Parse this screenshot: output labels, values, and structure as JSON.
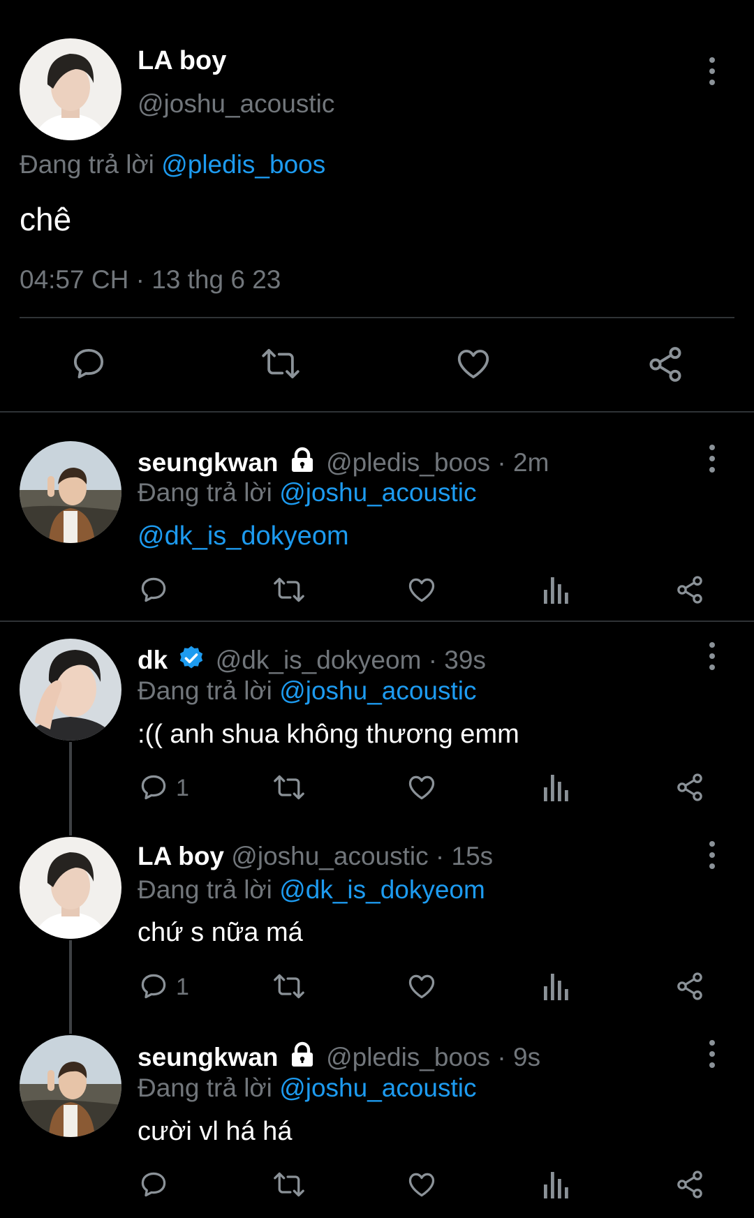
{
  "main_tweet": {
    "name": "LA boy",
    "handle": "@joshu_acoustic",
    "reply_prefix": "Đang trả lời",
    "reply_to": "@pledis_boos",
    "text": "chê",
    "timestamp": "04:57 CH · 13 thg 6 23"
  },
  "replies": [
    {
      "name": "seungkwan",
      "handle": "@pledis_boos",
      "time": "· 2m",
      "reply_prefix": "Đang trả lời",
      "reply_to": "@joshu_acoustic",
      "text": "@dk_is_dokyeom",
      "reply_count": "",
      "badge": "lock-icon"
    },
    {
      "name": "dk",
      "handle": "@dk_is_dokyeom",
      "time": "· 39s",
      "reply_prefix": "Đang trả lời",
      "reply_to": "@joshu_acoustic",
      "text": ":(( anh shua không thương emm",
      "reply_count": "1",
      "badge": "verified-icon"
    },
    {
      "name": "LA boy",
      "handle": "@joshu_acoustic",
      "time": "· 15s",
      "reply_prefix": "Đang trả lời",
      "reply_to": "@dk_is_dokyeom",
      "text": "chứ s nữa má",
      "reply_count": "1",
      "badge": ""
    },
    {
      "name": "seungkwan",
      "handle": "@pledis_boos",
      "time": "· 9s",
      "reply_prefix": "Đang trả lời",
      "reply_to": "@joshu_acoustic",
      "text": "cười vl há há",
      "reply_count": "",
      "badge": "lock-icon"
    }
  ],
  "colors": {
    "background": "#000000",
    "link": "#1d9bf0",
    "secondary_text": "#71767b",
    "verified": "#1d9bf0",
    "divider": "#2f3336"
  }
}
